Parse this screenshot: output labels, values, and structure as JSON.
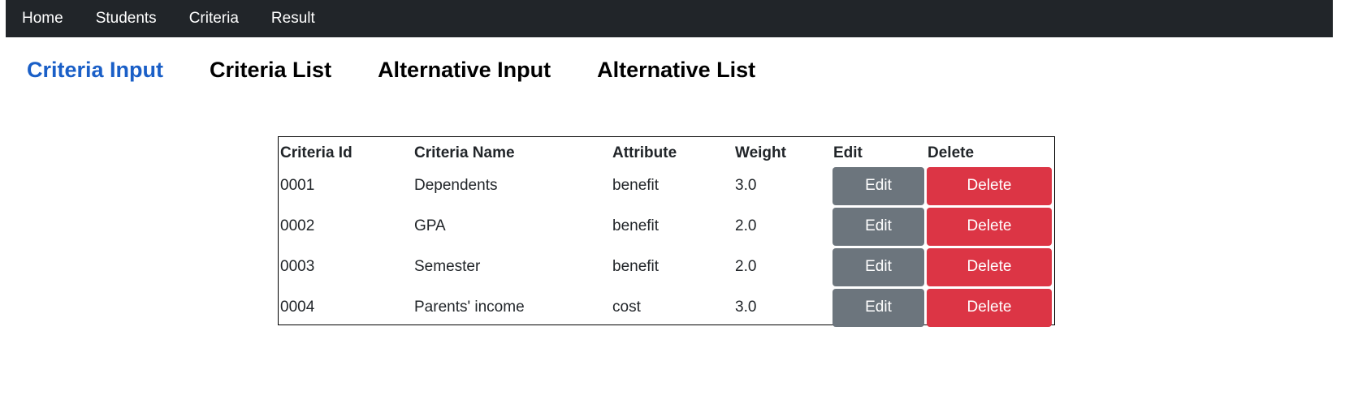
{
  "navbar": {
    "items": [
      {
        "label": "Home"
      },
      {
        "label": "Students"
      },
      {
        "label": "Criteria"
      },
      {
        "label": "Result"
      }
    ],
    "background": "#212529"
  },
  "subnav": {
    "links": [
      {
        "label": "Criteria Input",
        "active": true
      },
      {
        "label": "Criteria List",
        "active": false
      },
      {
        "label": "Alternative Input",
        "active": false
      },
      {
        "label": "Alternative List",
        "active": false
      }
    ],
    "active_color": "#1a5fc7"
  },
  "table": {
    "headers": [
      "Criteria Id",
      "Criteria Name",
      "Attribute",
      "Weight",
      "Edit",
      "Delete"
    ],
    "rows": [
      {
        "id": "0001",
        "name": "Dependents",
        "attribute": "benefit",
        "weight": "3.0",
        "edit": "Edit",
        "delete": "Delete"
      },
      {
        "id": "0002",
        "name": "GPA",
        "attribute": "benefit",
        "weight": "2.0",
        "edit": "Edit",
        "delete": "Delete"
      },
      {
        "id": "0003",
        "name": "Semester",
        "attribute": "benefit",
        "weight": "2.0",
        "edit": "Edit",
        "delete": "Delete"
      },
      {
        "id": "0004",
        "name": "Parents' income",
        "attribute": "cost",
        "weight": "3.0",
        "edit": "Edit",
        "delete": "Delete"
      }
    ],
    "edit_color": "#6c757d",
    "delete_color": "#dc3545"
  }
}
